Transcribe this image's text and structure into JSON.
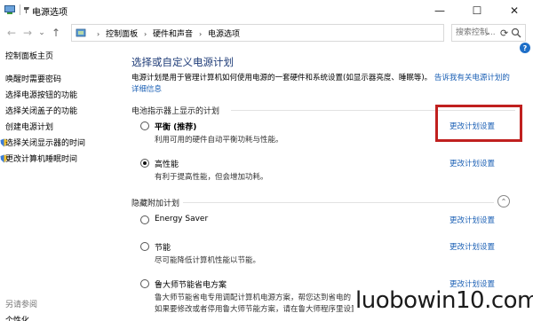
{
  "window": {
    "title": "电源选项",
    "minimize": "—",
    "maximize": "☐",
    "close": "✕"
  },
  "nav": {
    "back": "←",
    "forward": "→",
    "dropdown": "⌄",
    "up": "↑"
  },
  "address": {
    "crumbs": [
      "控制面板",
      "硬件和声音",
      "电源选项"
    ],
    "separator": "›",
    "dropdown": "⌄",
    "refresh": "⟳"
  },
  "search": {
    "placeholder": "搜索控制..."
  },
  "help": "?",
  "sidebar": {
    "home": "控制面板主页",
    "links": [
      "唤醒时需要密码",
      "选择电源按钮的功能",
      "选择关闭盖子的功能",
      "创建电源计划",
      "选择关闭显示器的时间",
      "更改计算机睡眠时间"
    ],
    "see_also": "另请参阅",
    "personalization": "个性化"
  },
  "main": {
    "heading": "选择或自定义电源计划",
    "description": "电源计划是用于管理计算机如何使用电源的一套硬件和系统设置(如显示器亮度、睡眠等)。",
    "description_link": "告诉我有关电源计划的详细信息",
    "battery_section": "电池指示器上显示的计划",
    "hidden_section": "隐藏附加计划",
    "collapse": "⌃",
    "change_label": "更改计划设置",
    "plans": [
      {
        "name": "平衡 (推荐)",
        "desc": "利用可用的硬件自动平衡功耗与性能。",
        "selected": false
      },
      {
        "name": "高性能",
        "desc": "有利于提高性能，但会增加功耗。",
        "selected": true
      },
      {
        "name": "Energy Saver",
        "desc": "",
        "selected": false
      },
      {
        "name": "节能",
        "desc": "尽可能降低计算机性能以节能。",
        "selected": false
      },
      {
        "name": "鲁大师节能省电方案",
        "desc": "鲁大师节能省电专用调配计算机电源方案，帮您达到省电的",
        "desc2": "如果要修改或者停用鲁大师节能方案，请在鲁大师程序里设置",
        "selected": false
      }
    ]
  },
  "watermark": "luobowin10.com",
  "colors": {
    "link": "#1a5fb4",
    "heading": "#1f3c78",
    "highlight_box": "#c0201f"
  }
}
